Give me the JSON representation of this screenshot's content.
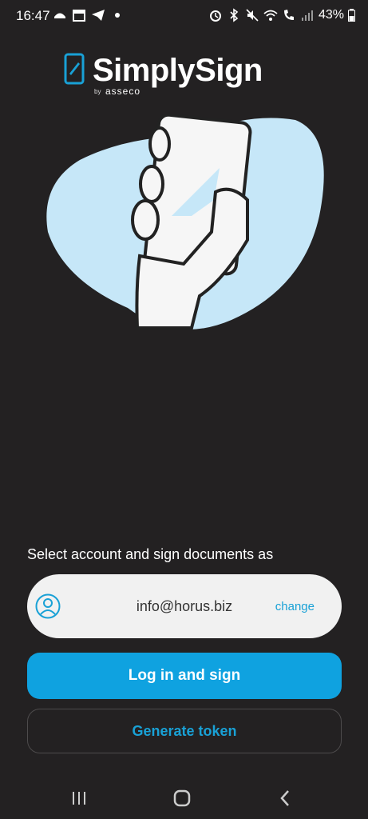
{
  "status_bar": {
    "time": "16:47",
    "battery": "43%",
    "left_icons": [
      "food-delivery-icon",
      "calendar-icon",
      "telegram-icon",
      "dot-icon"
    ],
    "right_icons": [
      "alarm-icon",
      "bluetooth-icon",
      "mute-icon",
      "wifi-icon",
      "call-signal-icon",
      "signal-icon",
      "battery-icon"
    ]
  },
  "logo": {
    "title": "SimplySign",
    "by": "by",
    "brand": "asseco"
  },
  "prompt": "Select account and sign documents as",
  "account": {
    "email": "info@horus.biz",
    "change_label": "change"
  },
  "buttons": {
    "login": "Log in and sign",
    "token": "Generate token"
  },
  "colors": {
    "accent": "#0fa2e0",
    "link": "#19a1d6",
    "background": "#232122",
    "blob": "#c6e7f8"
  }
}
